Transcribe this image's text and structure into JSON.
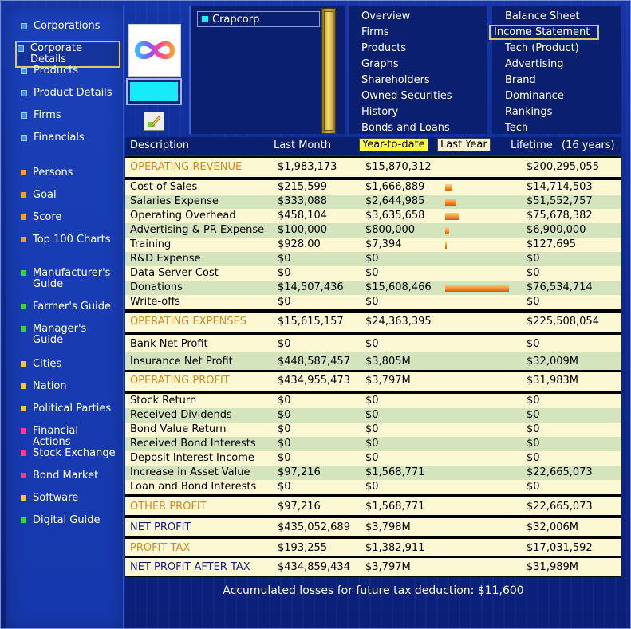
{
  "sidebar": {
    "items": [
      {
        "label": "Corporations",
        "color": "blue"
      },
      {
        "label": "Corporate Details",
        "color": "blue",
        "active": true
      },
      {
        "label": "Products",
        "color": "blue"
      },
      {
        "label": "Product Details",
        "color": "blue"
      },
      {
        "label": "Firms",
        "color": "blue"
      },
      {
        "label": "Financials",
        "color": "blue"
      },
      {
        "label": "Persons",
        "color": "orange"
      },
      {
        "label": "Goal",
        "color": "orange"
      },
      {
        "label": "Score",
        "color": "orange"
      },
      {
        "label": "Top 100 Charts",
        "color": "orange"
      },
      {
        "label": "Manufacturer's Guide",
        "color": "green"
      },
      {
        "label": "Farmer's Guide",
        "color": "green"
      },
      {
        "label": "Manager's Guide",
        "color": "green"
      },
      {
        "label": "Cities",
        "color": "yellow"
      },
      {
        "label": "Nation",
        "color": "yellow"
      },
      {
        "label": "Political Parties",
        "color": "yellow"
      },
      {
        "label": "Financial Actions",
        "color": "pink"
      },
      {
        "label": "Stock Exchange",
        "color": "pink"
      },
      {
        "label": "Bond Market",
        "color": "pink"
      },
      {
        "label": "Software",
        "color": "yellow"
      },
      {
        "label": "Digital Guide",
        "color": "green"
      }
    ]
  },
  "company": {
    "logo_icon": "infinity-logo-icon",
    "color": "#17ebf7",
    "edit_icon": "edit-pencil-icon"
  },
  "firm_list": {
    "items": [
      "Crapcorp"
    ]
  },
  "menu_center": {
    "items": [
      "Overview",
      "Firms",
      "Products",
      "Graphs",
      "Shareholders",
      "Owned Securities",
      "History",
      "Bonds and Loans"
    ]
  },
  "menu_right": {
    "items": [
      "Balance Sheet",
      "Income Statement",
      "Tech (Product)",
      "Advertising",
      "Brand",
      "Dominance",
      "Rankings",
      "Tech"
    ],
    "active_index": 1
  },
  "table": {
    "columns": {
      "description": "Description",
      "last_month": "Last Month",
      "ytd": "Year-to-date",
      "last_year": "Last Year",
      "lifetime": "Lifetime",
      "lifetime_years": "(16 years)"
    },
    "sections": [
      {
        "type": "header",
        "rows": [
          {
            "desc": "OPERATING REVENUE",
            "lm": "$1,983,173",
            "ytd": "$15,870,312",
            "life": "$200,295,055"
          }
        ]
      },
      {
        "type": "detail",
        "rows": [
          {
            "desc": "Cost of Sales",
            "lm": "$215,599",
            "ytd": "$1,666,889",
            "life": "$14,714,503",
            "bar": 0.11
          },
          {
            "desc": "Salaries Expense",
            "lm": "$333,088",
            "ytd": "$2,644,985",
            "life": "$51,552,757",
            "bar": 0.17
          },
          {
            "desc": "Operating Overhead",
            "lm": "$458,104",
            "ytd": "$3,635,658",
            "life": "$75,678,382",
            "bar": 0.23
          },
          {
            "desc": "Advertising & PR Expense",
            "lm": "$100,000",
            "ytd": "$800,000",
            "life": "$6,900,000",
            "bar": 0.06
          },
          {
            "desc": "Training",
            "lm": "$928.00",
            "ytd": "$7,394",
            "life": "$127,695",
            "bar": 0.01
          },
          {
            "desc": "R&D Expense",
            "lm": "$0",
            "ytd": "$0",
            "life": "$0"
          },
          {
            "desc": "Data Server Cost",
            "lm": "$0",
            "ytd": "$0",
            "life": "$0"
          },
          {
            "desc": "Donations",
            "lm": "$14,507,436",
            "ytd": "$15,608,466",
            "life": "$76,534,714",
            "bar": 1.0
          },
          {
            "desc": "Write-offs",
            "lm": "$0",
            "ytd": "$0",
            "life": "$0"
          }
        ]
      },
      {
        "type": "header",
        "rows": [
          {
            "desc": "OPERATING EXPENSES",
            "lm": "$15,615,157",
            "ytd": "$24,363,395",
            "life": "$225,508,054"
          }
        ]
      },
      {
        "type": "detail2",
        "rows": [
          {
            "desc": "Bank Net Profit",
            "lm": "$0",
            "ytd": "$0",
            "life": "$0"
          },
          {
            "desc": "Insurance Net Profit",
            "lm": "$448,587,457",
            "ytd": "$3,805M",
            "life": "$32,009M"
          }
        ]
      },
      {
        "type": "header",
        "rows": [
          {
            "desc": "OPERATING PROFIT",
            "lm": "$434,955,473",
            "ytd": "$3,797M",
            "life": "$31,983M"
          }
        ]
      },
      {
        "type": "detail",
        "rows": [
          {
            "desc": "Stock Return",
            "lm": "$0",
            "ytd": "$0",
            "life": "$0"
          },
          {
            "desc": "Received Dividends",
            "lm": "$0",
            "ytd": "$0",
            "life": "$0"
          },
          {
            "desc": "Bond Value Return",
            "lm": "$0",
            "ytd": "$0",
            "life": "$0"
          },
          {
            "desc": "Received Bond Interests",
            "lm": "$0",
            "ytd": "$0",
            "life": "$0"
          },
          {
            "desc": "Deposit Interest Income",
            "lm": "$0",
            "ytd": "$0",
            "life": "$0"
          },
          {
            "desc": "Increase in Asset Value",
            "lm": "$97,216",
            "ytd": "$1,568,771",
            "life": "$22,665,073"
          },
          {
            "desc": "Loan and Bond Interests",
            "lm": "$0",
            "ytd": "$0",
            "life": "$0"
          }
        ]
      },
      {
        "type": "header",
        "rows": [
          {
            "desc": "OTHER PROFIT",
            "lm": "$97,216",
            "ytd": "$1,568,771",
            "life": "$22,665,073"
          }
        ]
      },
      {
        "type": "net",
        "rows": [
          {
            "desc": "NET PROFIT",
            "lm": "$435,052,689",
            "ytd": "$3,798M",
            "life": "$32,006M"
          }
        ]
      },
      {
        "type": "header",
        "rows": [
          {
            "desc": "PROFIT TAX",
            "lm": "$193,255",
            "ytd": "$1,382,911",
            "life": "$17,031,592"
          }
        ]
      },
      {
        "type": "net",
        "rows": [
          {
            "desc": "NET PROFIT AFTER TAX",
            "lm": "$434,859,434",
            "ytd": "$3,797M",
            "life": "$31,989M"
          }
        ]
      }
    ]
  },
  "footer": {
    "note": "Accumulated losses for future tax deduction: $11,600"
  }
}
